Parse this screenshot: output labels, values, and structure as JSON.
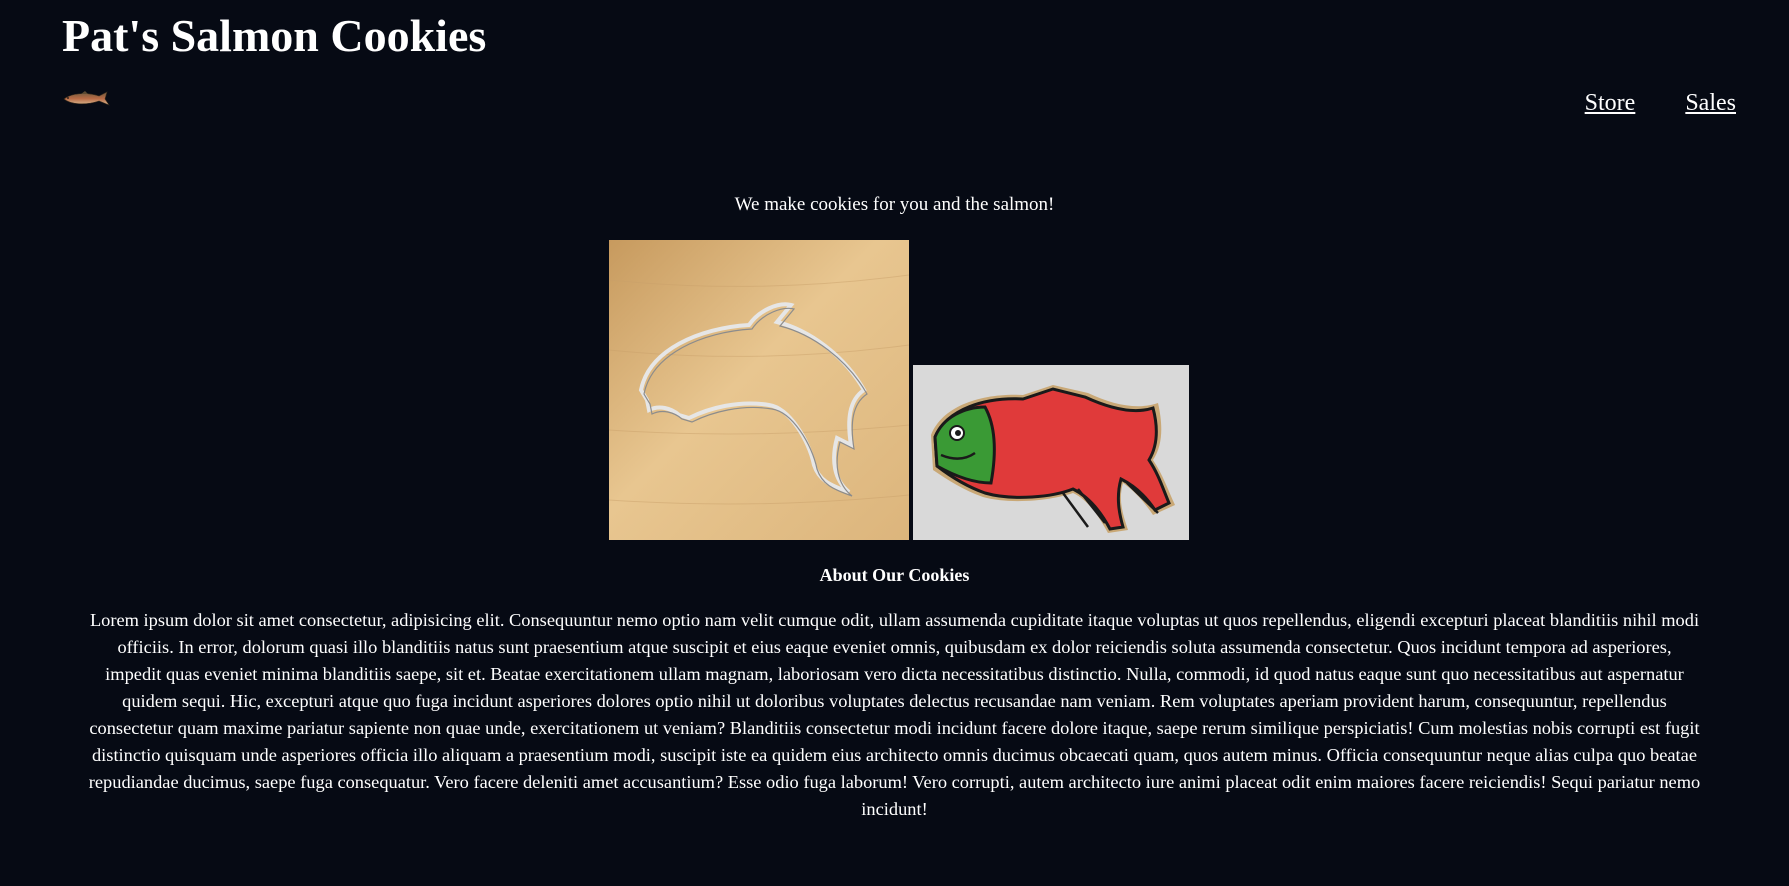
{
  "header": {
    "title": "Pat's Salmon Cookies",
    "logo_icon": "salmon-fish-icon"
  },
  "nav": {
    "links": [
      {
        "label": "Store"
      },
      {
        "label": "Sales"
      }
    ]
  },
  "main": {
    "tagline": "We make cookies for you and the salmon!",
    "images": [
      {
        "icon": "salmon-cookie-cutter-photo"
      },
      {
        "icon": "decorated-salmon-cookie-photo"
      }
    ],
    "about_heading": "About Our Cookies",
    "about_text": "Lorem ipsum dolor sit amet consectetur, adipisicing elit. Consequuntur nemo optio nam velit cumque odit, ullam assumenda cupiditate itaque voluptas ut quos repellendus, eligendi excepturi placeat blanditiis nihil modi officiis. In error, dolorum quasi illo blanditiis natus sunt praesentium atque suscipit et eius eaque eveniet omnis, quibusdam ex dolor reiciendis soluta assumenda consectetur. Quos incidunt tempora ad asperiores, impedit quas eveniet minima blanditiis saepe, sit et. Beatae exercitationem ullam magnam, laboriosam vero dicta necessitatibus distinctio. Nulla, commodi, id quod natus eaque sunt quo necessitatibus aut aspernatur quidem sequi. Hic, excepturi atque quo fuga incidunt asperiores dolores optio nihil ut doloribus voluptates delectus recusandae nam veniam. Rem voluptates aperiam provident harum, consequuntur, repellendus consectetur quam maxime pariatur sapiente non quae unde, exercitationem ut veniam? Blanditiis consectetur modi incidunt facere dolore itaque, saepe rerum similique perspiciatis! Cum molestias nobis corrupti est fugit distinctio quisquam unde asperiores officia illo aliquam a praesentium modi, suscipit iste ea quidem eius architecto omnis ducimus obcaecati quam, quos autem minus. Officia consequuntur neque alias culpa quo beatae repudiandae ducimus, saepe fuga consequatur. Vero facere deleniti amet accusantium? Esse odio fuga laborum! Vero corrupti, autem architecto iure animi placeat odit enim maiores facere reiciendis! Sequi pariatur nemo incidunt!"
  },
  "colors": {
    "background": "#060a14",
    "text": "#ffffff"
  }
}
